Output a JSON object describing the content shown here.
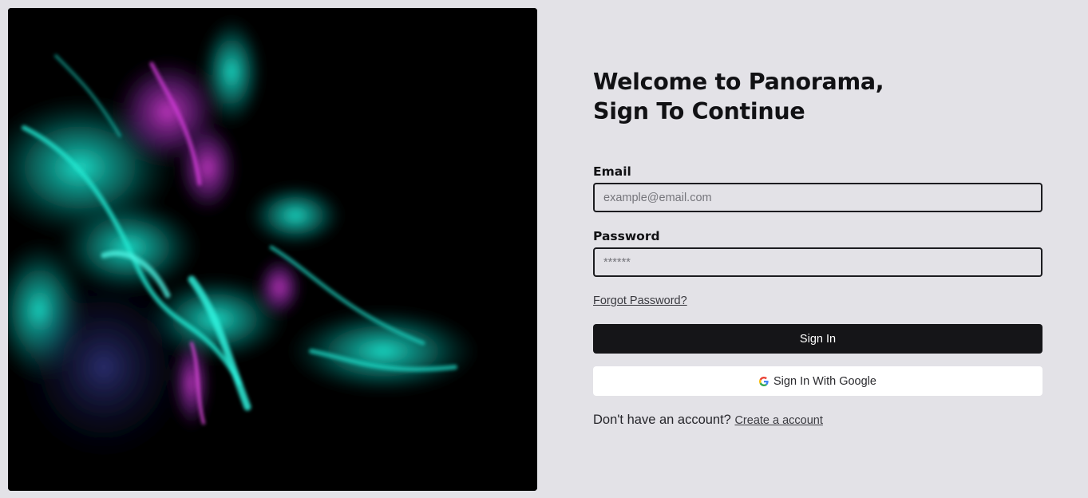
{
  "hero": {
    "image": "abstract-fluid-art-teal-magenta"
  },
  "heading": {
    "line1": "Welcome to Panorama,",
    "line2": "Sign To Continue"
  },
  "email": {
    "label": "Email",
    "placeholder": "example@email.com",
    "value": ""
  },
  "password": {
    "label": "Password",
    "placeholder": "******",
    "value": ""
  },
  "links": {
    "forgot": "Forgot Password?"
  },
  "buttons": {
    "sign_in": "Sign In",
    "google": "Sign In With Google",
    "google_icon": "google-g-icon"
  },
  "signup": {
    "text": "Don't have an account?",
    "link": "Create a account"
  },
  "colors": {
    "background": "#e3e2e7",
    "primary": "#151518",
    "accent_teal": "#18d8c4",
    "accent_magenta": "#c02fc0"
  }
}
